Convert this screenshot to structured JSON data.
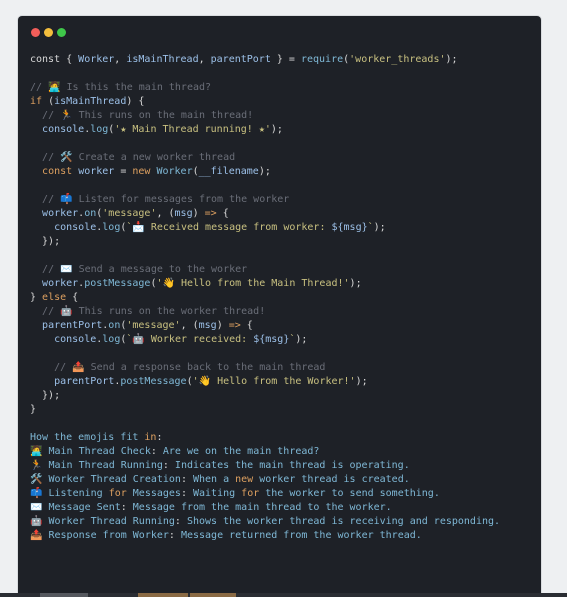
{
  "window": {
    "controls": [
      {
        "name": "close",
        "color": "#f25e5a"
      },
      {
        "name": "minimize",
        "color": "#f3be3d"
      },
      {
        "name": "maximize",
        "color": "#3fc74a"
      }
    ]
  },
  "code_lines": [
    [
      [
        "pl",
        "const { "
      ],
      [
        "var",
        "Worker"
      ],
      [
        "pl",
        ", "
      ],
      [
        "var",
        "isMainThread"
      ],
      [
        "pl",
        ", "
      ],
      [
        "var",
        "parentPort"
      ],
      [
        "pl",
        " } = "
      ],
      [
        "fn",
        "require"
      ],
      [
        "pl",
        "("
      ],
      [
        "str",
        "'worker_threads'"
      ],
      [
        "pl",
        ");"
      ]
    ],
    [],
    [
      [
        "cm",
        "// 🧑‍💻 Is this the main thread?"
      ]
    ],
    [
      [
        "kw",
        "if"
      ],
      [
        "pl",
        " ("
      ],
      [
        "var",
        "isMainThread"
      ],
      [
        "pl",
        ") {"
      ]
    ],
    [
      [
        "pl",
        "  "
      ],
      [
        "cm",
        "// 🏃 This runs on the main thread!"
      ]
    ],
    [
      [
        "pl",
        "  "
      ],
      [
        "var",
        "console"
      ],
      [
        "pl",
        "."
      ],
      [
        "fn",
        "log"
      ],
      [
        "pl",
        "("
      ],
      [
        "str",
        "'★ Main Thread running! ★'"
      ],
      [
        "pl",
        ");"
      ]
    ],
    [],
    [
      [
        "pl",
        "  "
      ],
      [
        "cm",
        "// 🛠️ Create a new worker thread"
      ]
    ],
    [
      [
        "pl",
        "  "
      ],
      [
        "kw",
        "const"
      ],
      [
        "pl",
        " "
      ],
      [
        "var",
        "worker"
      ],
      [
        "pl",
        " = "
      ],
      [
        "kw",
        "new"
      ],
      [
        "pl",
        " "
      ],
      [
        "fn",
        "Worker"
      ],
      [
        "pl",
        "("
      ],
      [
        "var",
        "__filename"
      ],
      [
        "pl",
        ");"
      ]
    ],
    [],
    [
      [
        "pl",
        "  "
      ],
      [
        "cm",
        "// 📫 Listen for messages from the worker"
      ]
    ],
    [
      [
        "pl",
        "  "
      ],
      [
        "var",
        "worker"
      ],
      [
        "pl",
        "."
      ],
      [
        "fn",
        "on"
      ],
      [
        "pl",
        "("
      ],
      [
        "str",
        "'message'"
      ],
      [
        "pl",
        ", ("
      ],
      [
        "var",
        "msg"
      ],
      [
        "pl",
        ") "
      ],
      [
        "kw",
        "=>"
      ],
      [
        "pl",
        " {"
      ]
    ],
    [
      [
        "pl",
        "    "
      ],
      [
        "var",
        "console"
      ],
      [
        "pl",
        "."
      ],
      [
        "fn",
        "log"
      ],
      [
        "pl",
        "("
      ],
      [
        "str",
        "`📩 Received message from worker: "
      ],
      [
        "var",
        "${msg}"
      ],
      [
        "str",
        "`"
      ],
      [
        "pl",
        ");"
      ]
    ],
    [
      [
        "pl",
        "  });"
      ]
    ],
    [],
    [
      [
        "pl",
        "  "
      ],
      [
        "cm",
        "// ✉️ Send a message to the worker"
      ]
    ],
    [
      [
        "pl",
        "  "
      ],
      [
        "var",
        "worker"
      ],
      [
        "pl",
        "."
      ],
      [
        "fn",
        "postMessage"
      ],
      [
        "pl",
        "("
      ],
      [
        "str",
        "'👋 Hello from the Main Thread!'"
      ],
      [
        "pl",
        ");"
      ]
    ],
    [
      [
        "pl",
        "} "
      ],
      [
        "kw",
        "else"
      ],
      [
        "pl",
        " {"
      ]
    ],
    [
      [
        "pl",
        "  "
      ],
      [
        "cm",
        "// 🤖 This runs on the worker thread!"
      ]
    ],
    [
      [
        "pl",
        "  "
      ],
      [
        "var",
        "parentPort"
      ],
      [
        "pl",
        "."
      ],
      [
        "fn",
        "on"
      ],
      [
        "pl",
        "("
      ],
      [
        "str",
        "'message'"
      ],
      [
        "pl",
        ", ("
      ],
      [
        "var",
        "msg"
      ],
      [
        "pl",
        ") "
      ],
      [
        "kw",
        "=>"
      ],
      [
        "pl",
        " {"
      ]
    ],
    [
      [
        "pl",
        "    "
      ],
      [
        "var",
        "console"
      ],
      [
        "pl",
        "."
      ],
      [
        "fn",
        "log"
      ],
      [
        "pl",
        "("
      ],
      [
        "str",
        "`🤖 Worker received: "
      ],
      [
        "var",
        "${msg}"
      ],
      [
        "str",
        "`"
      ],
      [
        "pl",
        ");"
      ]
    ],
    [],
    [
      [
        "pl",
        "    "
      ],
      [
        "cm",
        "// 📤 Send a response back to the main thread"
      ]
    ],
    [
      [
        "pl",
        "    "
      ],
      [
        "var",
        "parentPort"
      ],
      [
        "pl",
        "."
      ],
      [
        "fn",
        "postMessage"
      ],
      [
        "pl",
        "("
      ],
      [
        "str",
        "'👋 Hello from the Worker!'"
      ],
      [
        "pl",
        ");"
      ]
    ],
    [
      [
        "pl",
        "  });"
      ]
    ],
    [
      [
        "pl",
        "}"
      ]
    ],
    [],
    [
      [
        "sum",
        "How the emojis fit "
      ],
      [
        "kw",
        "in"
      ],
      [
        "pl",
        ":"
      ]
    ],
    [
      [
        "pl",
        "🧑‍💻 "
      ],
      [
        "sum",
        "Main Thread Check"
      ],
      [
        "pl",
        ": "
      ],
      [
        "sum",
        "Are we on the main thread?"
      ]
    ],
    [
      [
        "pl",
        "🏃 "
      ],
      [
        "sum",
        "Main Thread Running"
      ],
      [
        "pl",
        ": "
      ],
      [
        "sum",
        "Indicates the main thread is operating."
      ]
    ],
    [
      [
        "pl",
        "🛠️ "
      ],
      [
        "sum",
        "Worker Thread Creation"
      ],
      [
        "pl",
        ": "
      ],
      [
        "sum",
        "When a "
      ],
      [
        "kw",
        "new"
      ],
      [
        "sum",
        " worker thread is created."
      ]
    ],
    [
      [
        "pl",
        "📫 "
      ],
      [
        "sum",
        "Listening "
      ],
      [
        "kw",
        "for"
      ],
      [
        "sum",
        " Messages"
      ],
      [
        "pl",
        ": "
      ],
      [
        "sum",
        "Waiting "
      ],
      [
        "kw",
        "for"
      ],
      [
        "sum",
        " the worker to send something."
      ]
    ],
    [
      [
        "pl",
        "✉️ "
      ],
      [
        "sum",
        "Message Sent"
      ],
      [
        "pl",
        ": "
      ],
      [
        "sum",
        "Message from the main thread to the worker."
      ]
    ],
    [
      [
        "pl",
        "🤖 "
      ],
      [
        "sum",
        "Worker Thread Running"
      ],
      [
        "pl",
        ": "
      ],
      [
        "sum",
        "Shows the worker thread is receiving and responding."
      ]
    ],
    [
      [
        "pl",
        "📤 "
      ],
      [
        "sum",
        "Response from Worker"
      ],
      [
        "pl",
        ": "
      ],
      [
        "sum",
        "Message returned from the worker thread."
      ]
    ]
  ]
}
